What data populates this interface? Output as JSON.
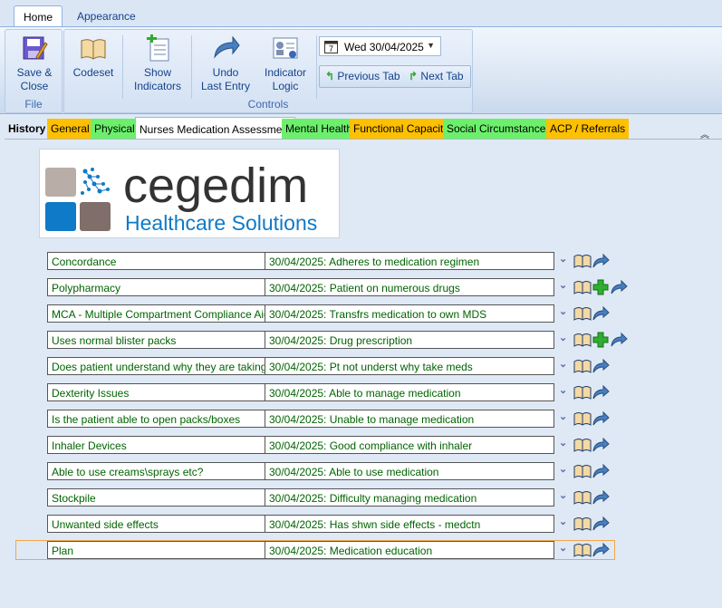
{
  "ribbon_tabs": [
    {
      "label": "Home",
      "active": true
    },
    {
      "label": "Appearance",
      "active": false
    }
  ],
  "file_group": {
    "label": "File",
    "save_close": [
      "Save &",
      "Close"
    ]
  },
  "controls_group": {
    "label": "Controls",
    "codeset": "Codeset",
    "show_indicators": [
      "Show",
      "Indicators"
    ],
    "undo_last_entry": [
      "Undo",
      "Last Entry"
    ],
    "indicator_logic": [
      "Indicator",
      "Logic"
    ],
    "date": "Wed 30/04/2025",
    "previous_tab": "Previous Tab",
    "next_tab": "Next Tab"
  },
  "form_tabs": [
    {
      "label": "History",
      "color": "#dfe9f5"
    },
    {
      "label": "General",
      "color": "#ffc000"
    },
    {
      "label": "Physical",
      "color": "#6cf06c"
    },
    {
      "label": "Nurses Medication Assessment",
      "color": "#ffffff"
    },
    {
      "label": "Mental Health",
      "color": "#6cf06c"
    },
    {
      "label": "Functional Capacity",
      "color": "#ffc000"
    },
    {
      "label": "Social Circumstances",
      "color": "#6cf06c"
    },
    {
      "label": "ACP / Referrals",
      "color": "#ffc000"
    }
  ],
  "logo": {
    "name": "cegedim",
    "tagline": "Healthcare Solutions"
  },
  "rows": [
    {
      "label": "Concordance",
      "value": "30/04/2025: Adheres to medication regimen",
      "add": false
    },
    {
      "label": "Polypharmacy",
      "value": "30/04/2025: Patient on numerous drugs",
      "add": true
    },
    {
      "label": "MCA - Multiple Compartment Compliance Aid",
      "value": "30/04/2025: Transfrs medication to own MDS",
      "add": false
    },
    {
      "label": "Uses normal blister packs",
      "value": "30/04/2025: Drug prescription",
      "add": true
    },
    {
      "label": "Does patient understand why they are taking m...",
      "value": "30/04/2025: Pt not underst why take meds",
      "add": false
    },
    {
      "label": "Dexterity Issues",
      "value": "30/04/2025: Able to manage medication",
      "add": false
    },
    {
      "label": "Is the patient able to open packs/boxes",
      "value": "30/04/2025: Unable to manage medication",
      "add": false
    },
    {
      "label": "Inhaler Devices",
      "value": "30/04/2025: Good compliance with inhaler",
      "add": false
    },
    {
      "label": "Able to use creams\\sprays etc?",
      "value": "30/04/2025: Able to use medication",
      "add": false
    },
    {
      "label": "Stockpile",
      "value": "30/04/2025: Difficulty managing medication",
      "add": false
    },
    {
      "label": "Unwanted side effects",
      "value": "30/04/2025: Has shwn side effects - medctn",
      "add": false
    },
    {
      "label": "Plan",
      "value": "30/04/2025: Medication education",
      "add": false
    }
  ],
  "colors": {
    "accent": "#15428b",
    "row_text": "#006400",
    "focus": "#f4a64a"
  }
}
